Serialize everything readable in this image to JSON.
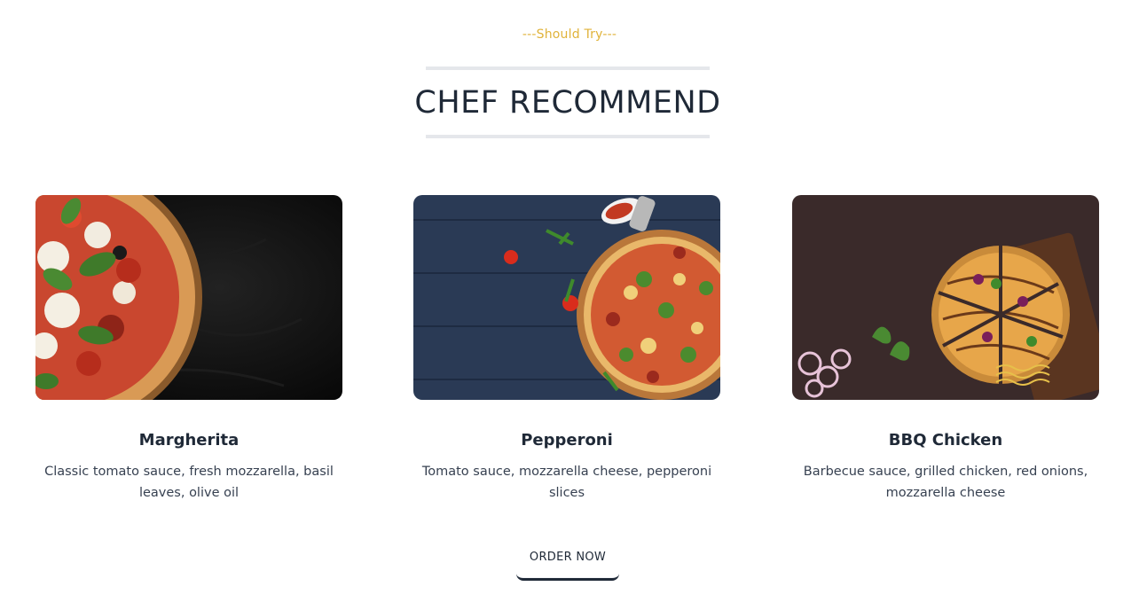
{
  "section": {
    "eyebrow": "---Should Try---",
    "title": "CHEF RECOMMEND"
  },
  "menu": [
    {
      "name": "Margherita",
      "description": "Classic tomato sauce, fresh mozzarella, basil leaves, olive oil",
      "image_icon": "margherita-pizza-image"
    },
    {
      "name": "Pepperoni",
      "description": "Tomato sauce, mozzarella cheese, pepperoni slices",
      "image_icon": "pepperoni-pizza-image"
    },
    {
      "name": "BBQ Chicken",
      "description": "Barbecue sauce, grilled chicken, red onions, mozzarella cheese",
      "image_icon": "bbq-chicken-pizza-image"
    }
  ],
  "cta": {
    "label": "ORDER NOW"
  },
  "colors": {
    "accent": "#e0b33a",
    "text": "#1f2937",
    "divider": "#e5e7eb"
  }
}
